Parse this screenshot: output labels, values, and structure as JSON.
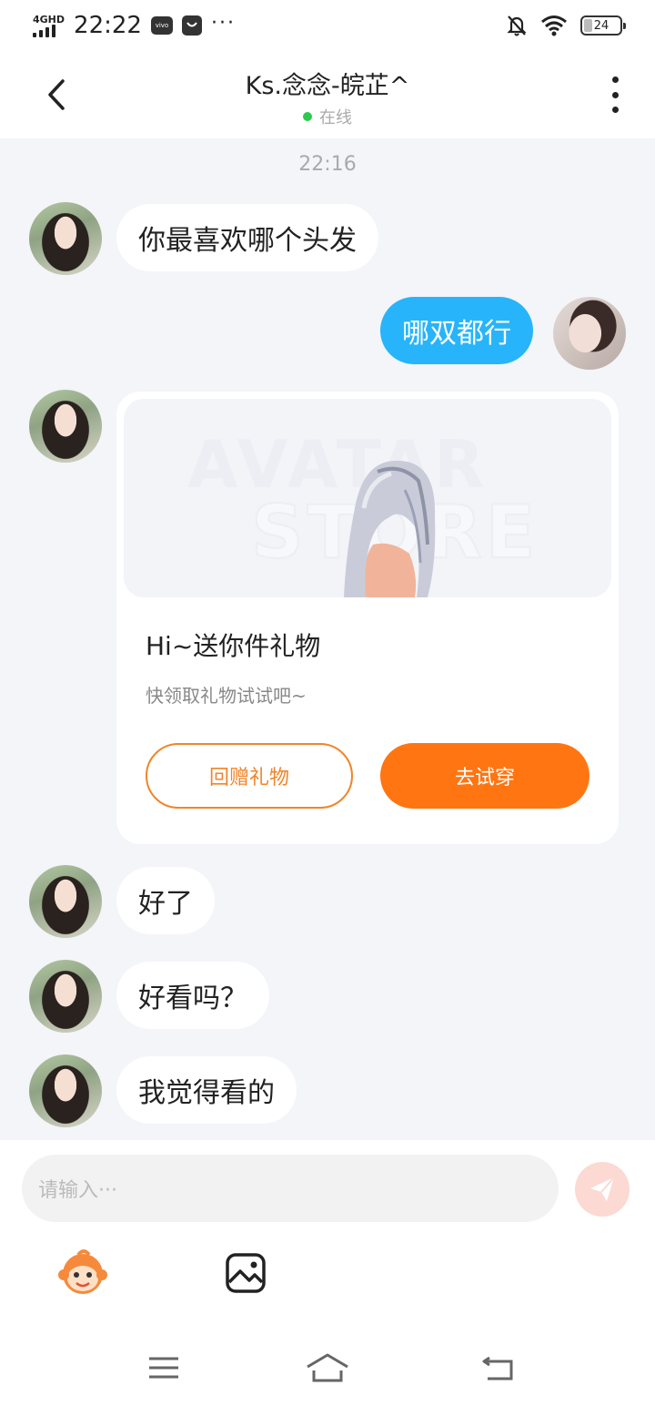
{
  "status_bar": {
    "network": "4GHD",
    "time": "22:22",
    "app_badge": "vivo",
    "more": "···",
    "battery": "24"
  },
  "header": {
    "title": "Ks.念念-皖芷^",
    "status": "在线",
    "status_color": "#2dc94c"
  },
  "chat": {
    "timestamp": "22:16",
    "messages": [
      {
        "from": "other",
        "text": "你最喜欢哪个头发"
      },
      {
        "from": "me",
        "text": "哪双都行"
      },
      {
        "from": "other",
        "type": "gift_card"
      },
      {
        "from": "other",
        "text": "好了"
      },
      {
        "from": "other",
        "text": "好看吗？"
      },
      {
        "from": "other",
        "text": "我觉得看的"
      }
    ],
    "gift_card": {
      "banner_watermark_line1": "AVATAR",
      "banner_watermark_line2": "STORE",
      "title": "Hi~送你件礼物",
      "subtitle": "快领取礼物试试吧~",
      "return_gift_label": "回赠礼物",
      "try_on_label": "去试穿",
      "accent_color": "#fe7512"
    }
  },
  "input": {
    "placeholder": "请输入···",
    "icons": [
      "emoji-icon",
      "image-icon",
      "send-icon"
    ]
  },
  "nav": {
    "icons": [
      "menu-icon",
      "home-icon",
      "back-icon"
    ]
  },
  "colors": {
    "chat_bg": "#f3f5f9",
    "my_bubble": "#27b4fa",
    "other_bubble": "#ffffff"
  }
}
